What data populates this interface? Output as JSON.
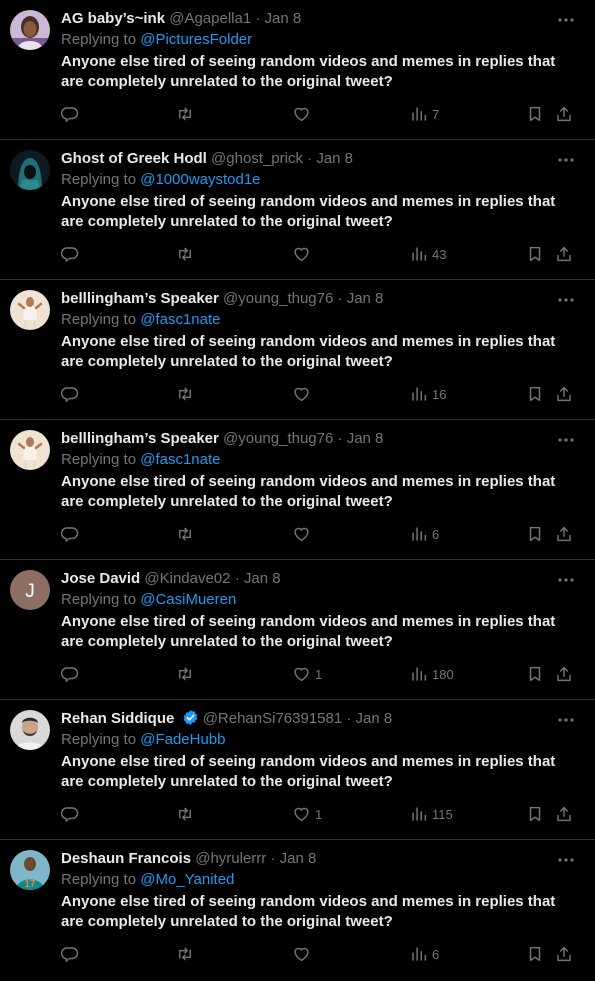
{
  "colors": {
    "background": "#000000",
    "text_primary": "#e7e9ea",
    "text_secondary": "#71767b",
    "link": "#1d9bf0",
    "divider": "#2f3336",
    "verified_badge": "#1d9bf0"
  },
  "reply_prefix": "Replying to",
  "tweets": [
    {
      "name": "AG baby’s~ink",
      "handle": "@Agapella1",
      "date": "Jan 8",
      "verified": false,
      "replying_to": "@PicturesFolder",
      "text": "Anyone else tired of seeing random videos and memes in replies that are completely unrelated to the original tweet?",
      "likes": "",
      "views": "7",
      "avatar": "photo-woman"
    },
    {
      "name": "Ghost of Greek Hodl",
      "handle": "@ghost_prick",
      "date": "Jan 8",
      "verified": false,
      "replying_to": "@1000waystod1e",
      "text": "Anyone else tired of seeing random videos and memes in replies that are completely unrelated to the original tweet?",
      "likes": "",
      "views": "43",
      "avatar": "photo-hooded-figure"
    },
    {
      "name": "belllingham’s Speaker",
      "handle": "@young_thug76",
      "date": "Jan 8",
      "verified": false,
      "replying_to": "@fasc1nate",
      "text": "Anyone else tired of seeing random videos and memes in replies that are completely unrelated to the original tweet?",
      "likes": "",
      "views": "16",
      "avatar": "photo-player"
    },
    {
      "name": "belllingham’s Speaker",
      "handle": "@young_thug76",
      "date": "Jan 8",
      "verified": false,
      "replying_to": "@fasc1nate",
      "text": "Anyone else tired of seeing random videos and memes in replies that are completely unrelated to the original tweet?",
      "likes": "",
      "views": "6",
      "avatar": "photo-player"
    },
    {
      "name": "Jose David",
      "handle": "@Kindave02",
      "date": "Jan 8",
      "verified": false,
      "replying_to": "@CasiMueren",
      "text": "Anyone else tired of seeing random videos and memes in replies that are completely unrelated to the original tweet?",
      "likes": "1",
      "views": "180",
      "avatar": "initial",
      "avatar_initial": "J"
    },
    {
      "name": "Rehan Siddique",
      "handle": "@RehanSi76391581",
      "date": "Jan 8",
      "verified": true,
      "replying_to": "@FadeHubb",
      "text": "Anyone else tired of seeing random videos and memes in replies that are completely unrelated to the original tweet?",
      "likes": "1",
      "views": "115",
      "avatar": "photo-man"
    },
    {
      "name": "Deshaun Francois",
      "handle": "@hyrulerrr",
      "date": "Jan 8",
      "verified": false,
      "replying_to": "@Mo_Yanited",
      "text": "Anyone else tired of seeing random videos and memes in replies that are completely unrelated to the original tweet?",
      "likes": "",
      "views": "6",
      "avatar": "photo-football-player"
    }
  ]
}
